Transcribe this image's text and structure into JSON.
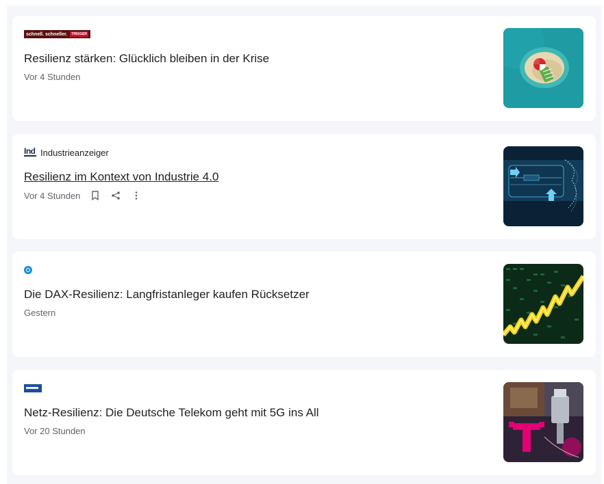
{
  "articles": [
    {
      "source": {
        "logo_text": "schnell. schneller. ",
        "logo_badge": "TRIGGER",
        "name": ""
      },
      "title": "Resilienz stärken: Glücklich bleiben in der Krise",
      "time": "Vor 4 Stunden",
      "thumb_icon": "island-beach-umbrella-image"
    },
    {
      "source": {
        "logo_text": "Ind",
        "name": "Industrieanzeiger"
      },
      "title": "Resilienz im Kontext von Industrie 4.0",
      "time": "Vor 4 Stunden",
      "thumb_icon": "digital-technology-interface-image",
      "actions": [
        "bookmark-icon",
        "share-icon",
        "more-icon"
      ]
    },
    {
      "source": {
        "logo_text": "",
        "name": ""
      },
      "title": "Die DAX-Resilienz: Langfristanleger kaufen Rücksetzer",
      "time": "Gestern",
      "thumb_icon": "stock-chart-image"
    },
    {
      "source": {
        "logo_text": "",
        "name": ""
      },
      "title": "Netz-Resilienz: Die Deutsche Telekom geht mit 5G ins All",
      "time": "Vor 20 Stunden",
      "thumb_icon": "telekom-satellite-collage-image"
    }
  ],
  "colors": {
    "page_bg": "#f4f6f9",
    "card_bg": "#ffffff",
    "headline": "#202124",
    "meta": "#5f6368",
    "trigger_red": "#c8102e",
    "telekom_magenta": "#e20074"
  }
}
